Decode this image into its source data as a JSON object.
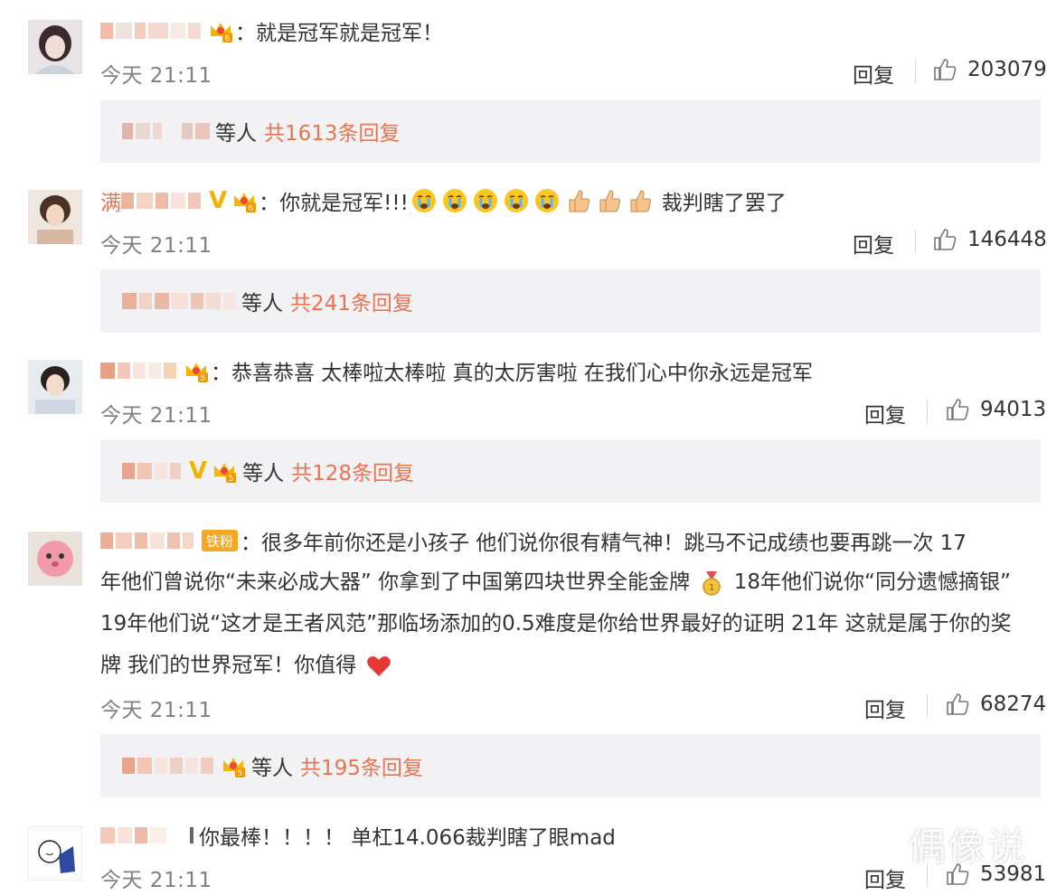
{
  "colors": {
    "accent": "#eb7350",
    "reply_bg": "#f2f2f5",
    "muted": "#808080",
    "vip_gold": "#f0b400"
  },
  "comments": [
    {
      "name_visible": "",
      "text": "：就是冠军就是冠军！",
      "time": "今天 21:11",
      "reply_label": "回复",
      "likes": "203079",
      "replies": {
        "suffix": "等人",
        "count": "共1613条回复"
      }
    },
    {
      "name_visible": "满",
      "text": "：你就是冠军!!!",
      "text_tail": "裁判瞎了罢了",
      "time": "今天 21:11",
      "reply_label": "回复",
      "likes": "146448",
      "replies": {
        "suffix": "等人",
        "count": "共241条回复"
      }
    },
    {
      "name_visible": "",
      "text": "：恭喜恭喜  太棒啦太棒啦  真的太厉害啦 在我们心中你永远是冠军",
      "time": "今天 21:11",
      "reply_label": "回复",
      "likes": "94013",
      "replies": {
        "suffix": "等人",
        "count": "共128条回复"
      }
    },
    {
      "name_visible": "",
      "fan_badge": "铁粉",
      "text_l1": "：很多年前你还是小孩子 他们说你很有精气神！跳马不记成绩也要再跳一次 17",
      "text_l2a": "年他们曾说你“未来必成大器” 你拿到了中国第四块世界全能金牌",
      "text_l2b": " 18年他们说你“同分遗憾摘银”",
      "text_l3": "19年他们说“这才是王者风范”那临场添加的0.5难度是你给世界最好的证明 21年 这就是属于你的奖",
      "text_l4": "牌 我们的世界冠军！你值得",
      "time": "今天 21:11",
      "reply_label": "回复",
      "likes": "68274",
      "replies": {
        "suffix": "等人",
        "count": "共195条回复"
      }
    },
    {
      "name_visible": "",
      "text": "你最棒！！！！ 单杠14.066裁判瞎了眼mad",
      "time": "今天 21:11",
      "reply_label": "回复",
      "likes": "53981"
    }
  ],
  "watermark": "偶像说",
  "icons": [
    "thumbs-up-icon",
    "crown-badge-icon",
    "crying-emoji",
    "thumbs-up-emoji",
    "gold-medal-emoji",
    "heart-emoji"
  ]
}
